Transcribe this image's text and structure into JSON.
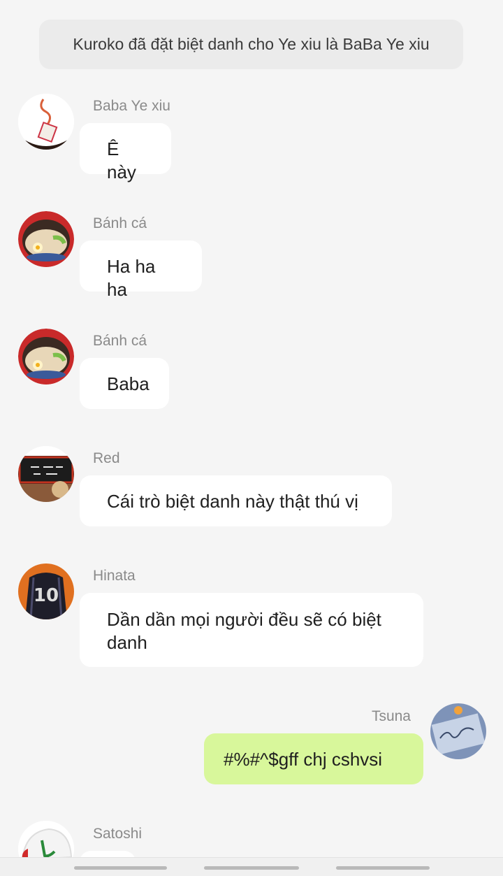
{
  "notice": "Kuroko đã đặt biệt danh cho Ye xiu là BaBa Ye xiu",
  "messages": [
    {
      "sender": "Baba Ye xiu",
      "text": "Ê này",
      "mine": false,
      "avatar": "paper-crane-avatar"
    },
    {
      "sender": "Bánh cá",
      "text": "Ha ha ha",
      "mine": false,
      "avatar": "ramen-bowl-avatar"
    },
    {
      "sender": "Bánh cá",
      "text": "Baba",
      "mine": false,
      "avatar": "ramen-bowl-avatar"
    },
    {
      "sender": "Red",
      "text": "Cái trò biệt danh này thật thú vị",
      "mine": false,
      "avatar": "chalkboard-avatar"
    },
    {
      "sender": "Hinata",
      "text": "Dần dần mọi người đều sẽ có biệt danh",
      "mine": false,
      "avatar": "jersey-10-avatar"
    },
    {
      "sender": "Tsuna",
      "text": "#%#^$gff chj cshvsi",
      "mine": true,
      "avatar": "signed-card-avatar"
    },
    {
      "sender": "Satoshi",
      "text": "",
      "mine": false,
      "avatar": "cap-avatar"
    }
  ],
  "nav_icons": [
    "recent-apps-icon",
    "home-icon",
    "back-icon"
  ],
  "colors": {
    "background": "#f5f5f5",
    "bubble_other": "#ffffff",
    "bubble_mine": "#d8f79b",
    "notice_bg": "#ebebeb",
    "sender_text": "#8a8a8a"
  }
}
